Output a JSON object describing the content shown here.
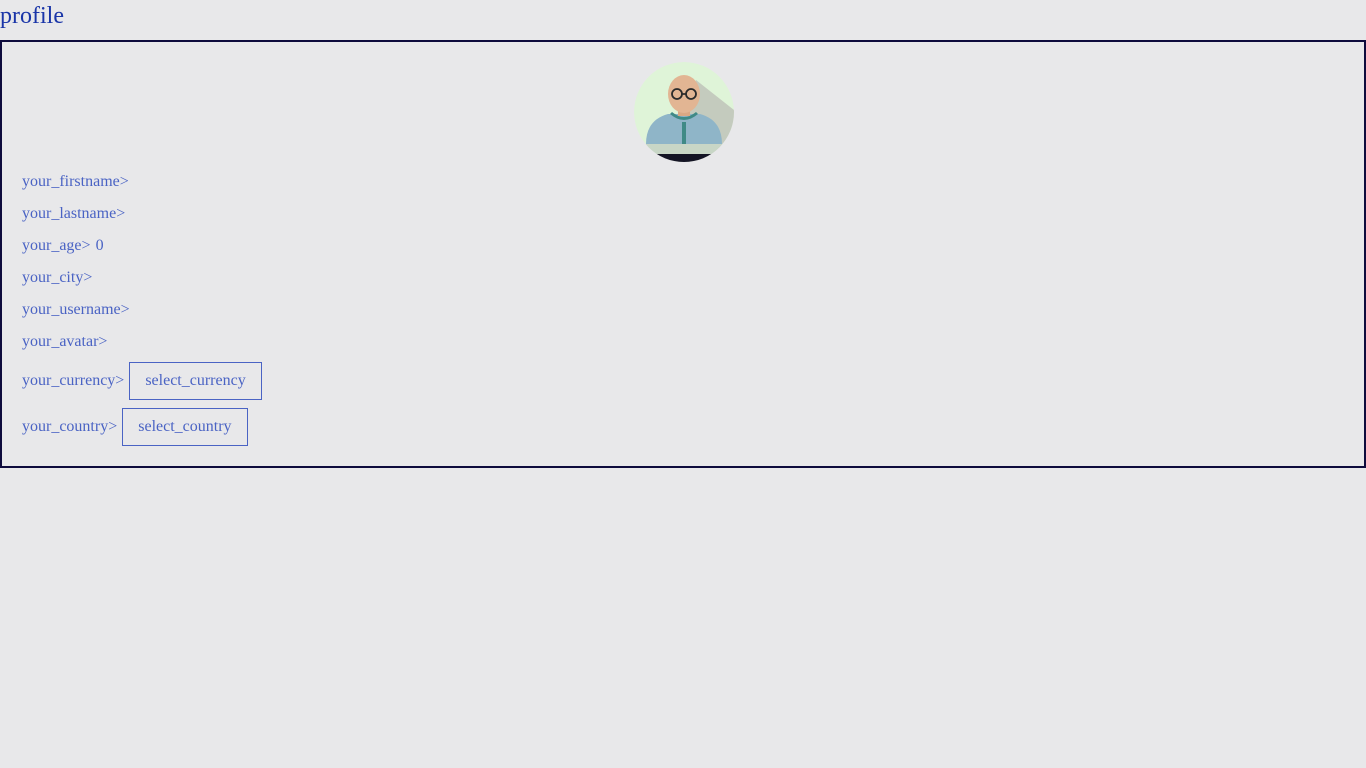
{
  "page": {
    "title": "profile"
  },
  "profile": {
    "avatar_icon": "person-with-glasses-avatar",
    "fields": {
      "firstname_label": "your_firstname>",
      "lastname_label": "your_lastname>",
      "age_label": "your_age>",
      "age_value": "0",
      "city_label": "your_city>",
      "username_label": "your_username>",
      "avatar_label": "your_avatar>",
      "currency_label": "your_currency>",
      "currency_select": "select_currency",
      "country_label": "your_country>",
      "country_select": "select_country"
    }
  },
  "colors": {
    "background": "#e8e8ea",
    "title": "#1a35a8",
    "text": "#4a63c4",
    "border": "#0e0b3d"
  }
}
